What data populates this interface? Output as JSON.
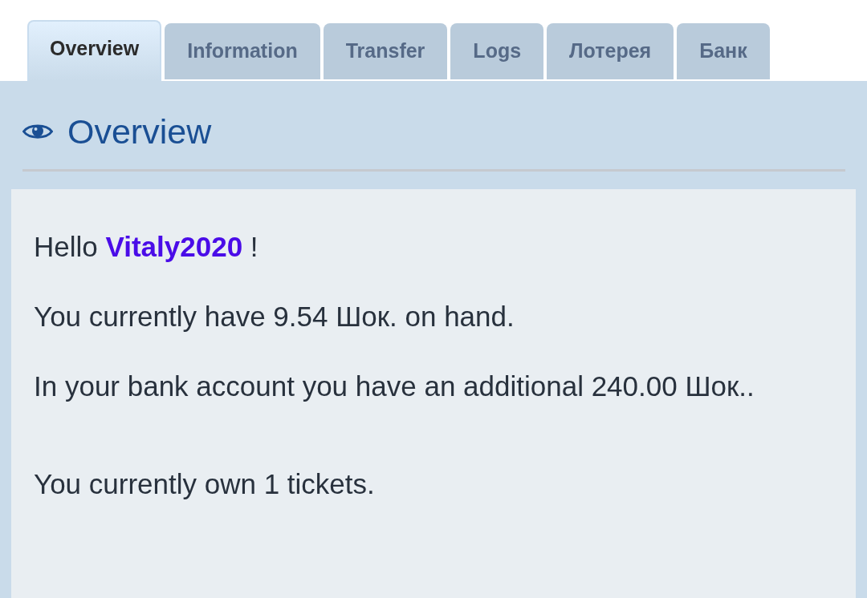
{
  "tabs": [
    {
      "label": "Overview",
      "selected": true
    },
    {
      "label": "Information",
      "selected": false
    },
    {
      "label": "Transfer",
      "selected": false
    },
    {
      "label": "Logs",
      "selected": false
    },
    {
      "label": "Лотерея",
      "selected": false
    },
    {
      "label": "Банк",
      "selected": false
    }
  ],
  "section": {
    "title": "Overview"
  },
  "content": {
    "balance_lines": [
      "Hello **Vitaly2020** !",
      "You currently have 9.54 Шок. on hand.",
      "In your bank account you have an additional 240.00 Шок.."
    ],
    "tickets_line": "You currently own 1 tickets."
  }
}
